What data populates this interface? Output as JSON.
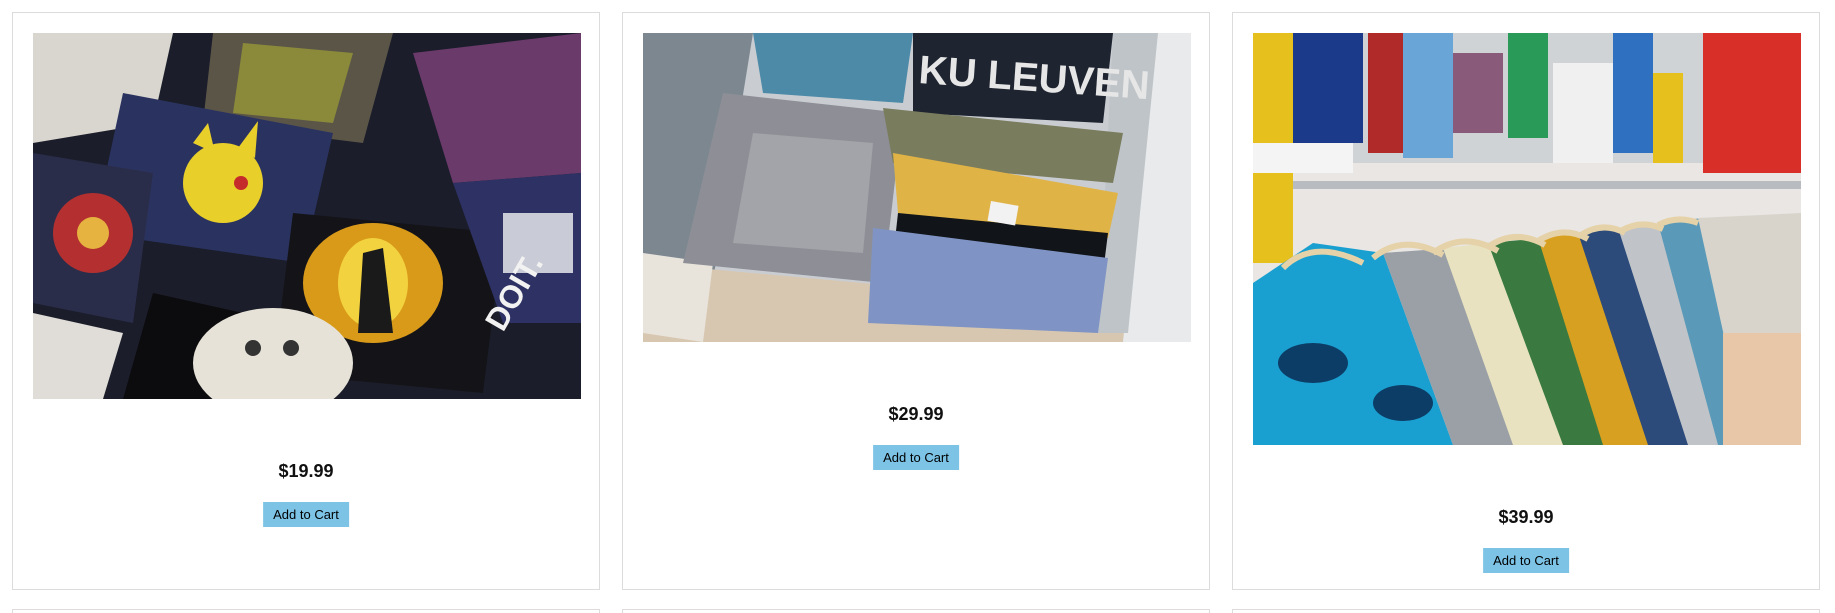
{
  "products": [
    {
      "price": "$19.99",
      "button_label": "Add to Cart",
      "image_alt": "Stack of printed graphic t-shirts"
    },
    {
      "price": "$29.99",
      "button_label": "Add to Cart",
      "image_alt": "Folded shirts in a drawer"
    },
    {
      "price": "$39.99",
      "button_label": "Add to Cart",
      "image_alt": "Hawaiian shirts on a clothing rack"
    }
  ],
  "image_text": {
    "shirt_print_1": "DOIT.",
    "shirt_print_2": "KU LEUVEN"
  },
  "colors": {
    "button_bg": "#7cc3e6",
    "card_border": "#dcdcdc"
  }
}
